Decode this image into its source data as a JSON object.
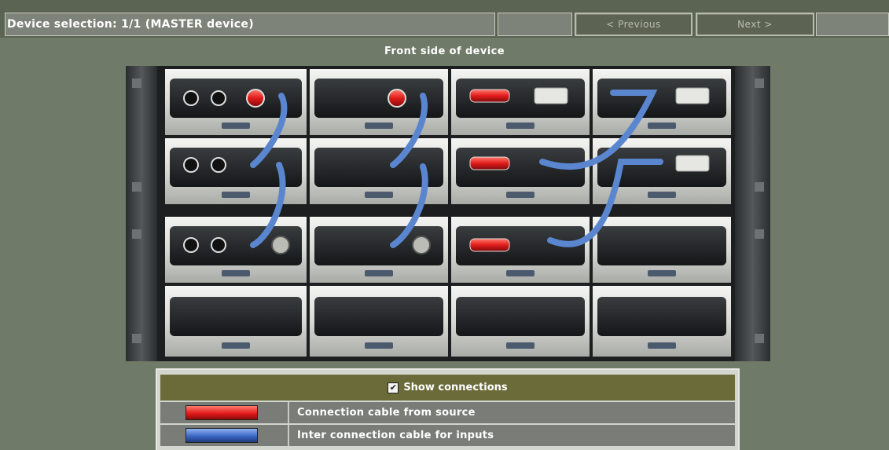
{
  "header": {
    "title": "Device selection: 1/1 (MASTER device)",
    "prev_label": "< Previous",
    "next_label": "Next >"
  },
  "rack": {
    "heading": "Front side of device"
  },
  "legend": {
    "show_connections_label": "Show connections",
    "show_connections_checked": true,
    "rows": [
      {
        "label": "Connection cable from source",
        "color": "#e21b1b"
      },
      {
        "label": "Inter connection cable for inputs",
        "color": "#3b67c6"
      }
    ]
  },
  "colors": {
    "background": "#6f7a68",
    "source_cable": "#e21b1b",
    "inter_cable": "#5a86d0",
    "legend_header": "#6a6b38"
  }
}
